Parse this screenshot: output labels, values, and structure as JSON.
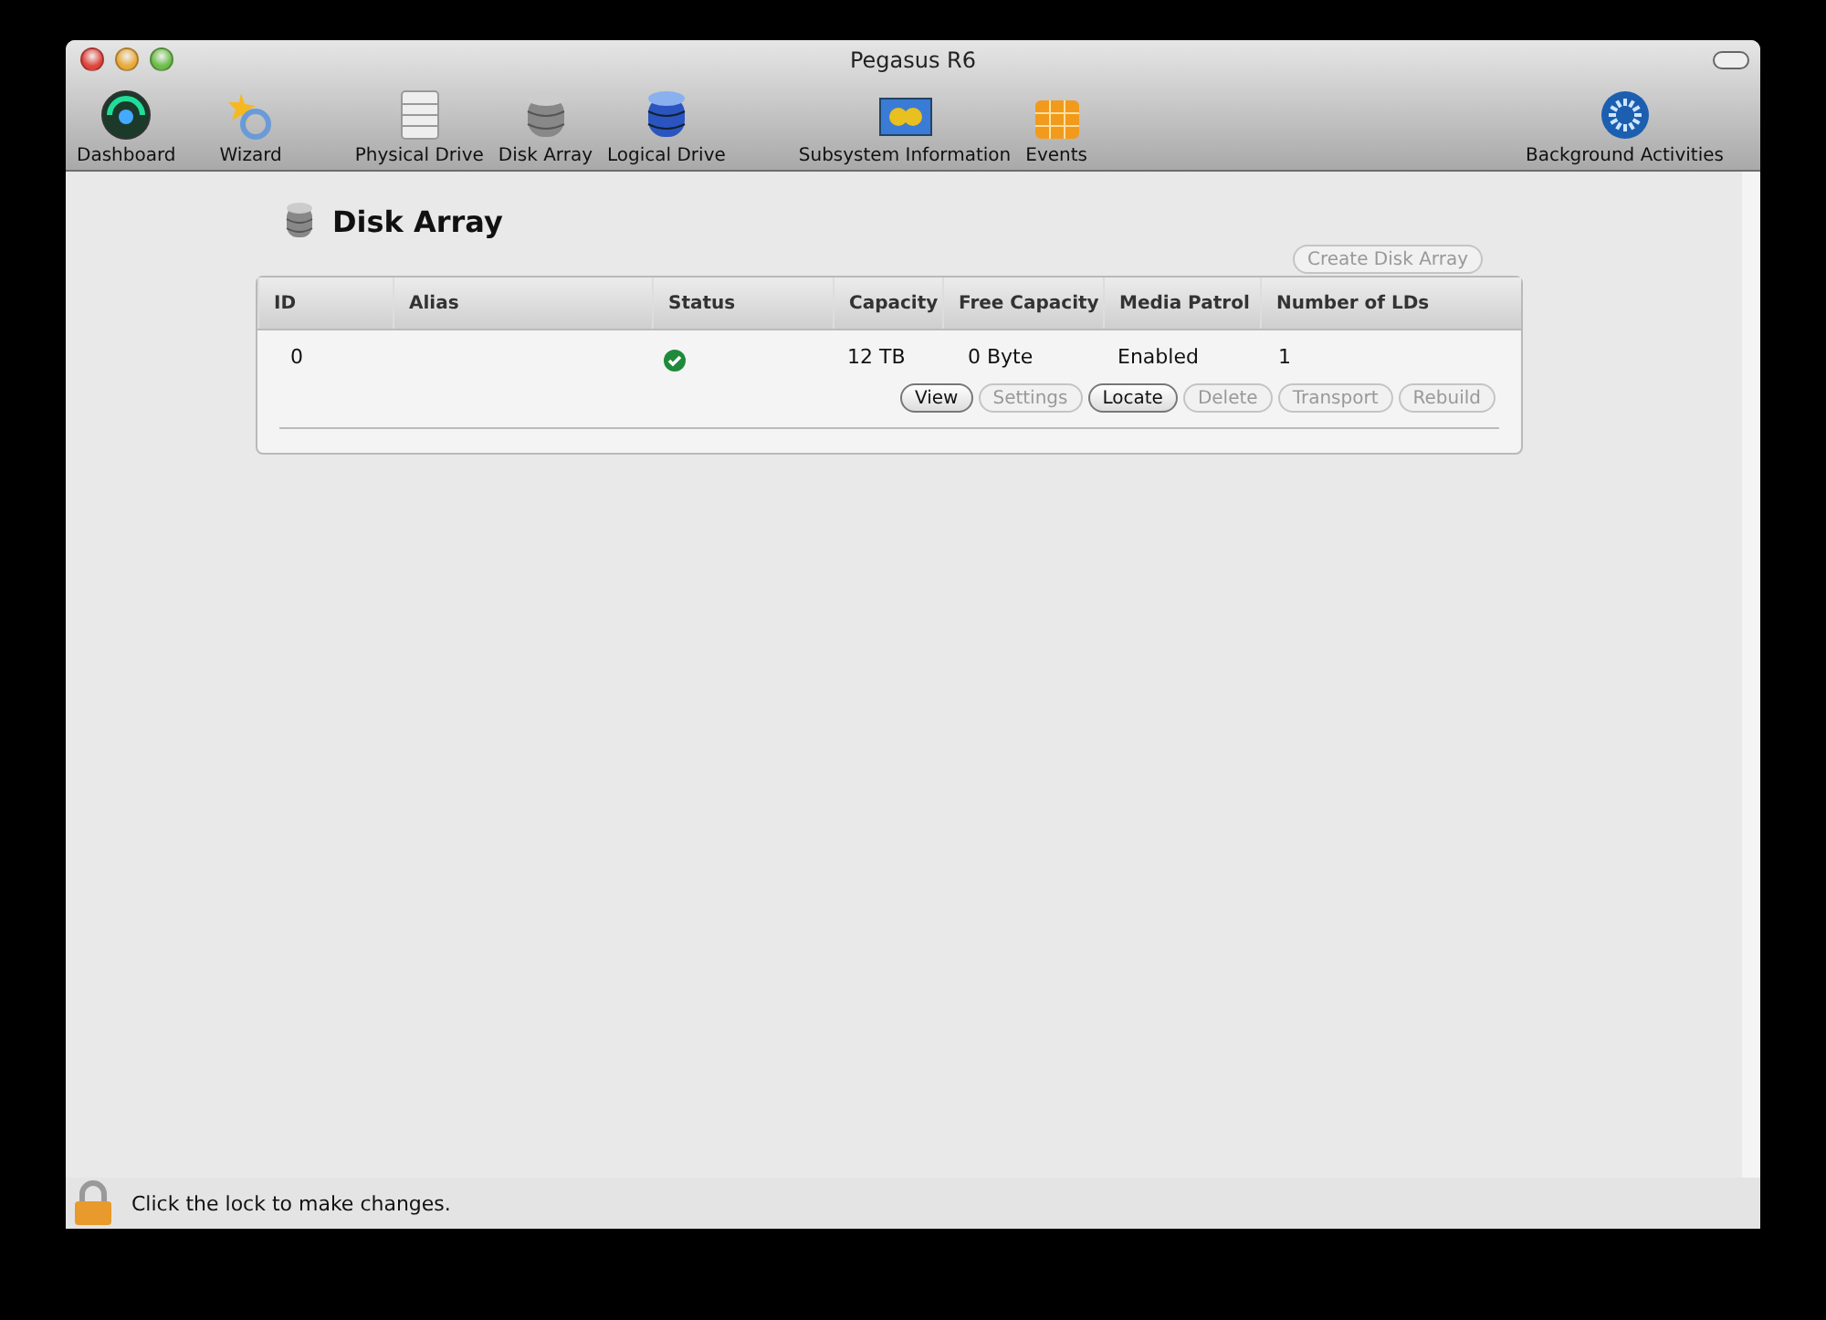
{
  "window": {
    "title": "Pegasus R6"
  },
  "toolbar": [
    {
      "label": "Dashboard"
    },
    {
      "label": "Wizard"
    },
    {
      "label": "Physical Drive"
    },
    {
      "label": "Disk Array"
    },
    {
      "label": "Logical Drive"
    },
    {
      "label": "Subsystem Information"
    },
    {
      "label": "Events"
    },
    {
      "label": "Background Activities"
    }
  ],
  "page": {
    "title": "Disk Array",
    "create_button": {
      "label": "Create Disk Array",
      "disabled": true
    }
  },
  "table": {
    "columns": [
      "ID",
      "Alias",
      "Status",
      "Capacity",
      "Free Capacity",
      "Media Patrol",
      "Number of LDs"
    ],
    "rows": [
      {
        "id": "0",
        "status_ok": true,
        "capacity": "12 TB",
        "free_capacity": "0 Byte",
        "media_patrol": "Enabled",
        "lds": "1",
        "actions": [
          {
            "label": "View",
            "disabled": false
          },
          {
            "label": "Settings",
            "disabled": true
          },
          {
            "label": "Locate",
            "disabled": false
          },
          {
            "label": "Delete",
            "disabled": true
          },
          {
            "label": "Transport",
            "disabled": true
          },
          {
            "label": "Rebuild",
            "disabled": true
          }
        ]
      }
    ]
  },
  "status_bar": {
    "text": "Click the lock to make changes.",
    "locked": true
  }
}
